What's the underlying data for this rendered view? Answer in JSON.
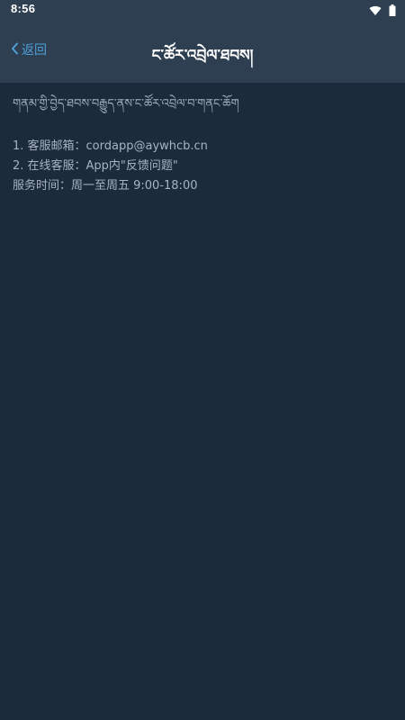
{
  "status_bar": {
    "time": "8:56",
    "icons": [
      "wifi-icon",
      "battery-icon"
    ]
  },
  "nav": {
    "back_icon": "chevron-left-icon",
    "back_label": "返回",
    "title": "ང་ཚོར་འབྲེལ་ཐབས།"
  },
  "content": {
    "intro": "གནམ་གྱི་བྱེད་ཐབས་བརྒྱུད་ནས་ང་ཚོར་འབྲེལ་བ་གནང་ཆོག",
    "lines": [
      "1. 客服邮箱：cordapp@aywhcb.cn",
      "2. 在线客服：App内\"反馈问题\"",
      "服务时间：周一至周五 9:00-18:00"
    ]
  },
  "colors": {
    "page_background": "#1b2b3c",
    "header_background": "#2d3f51",
    "accent": "#4f9fd8",
    "body_text": "#a7b3bf",
    "title_text": "#ffffff"
  }
}
